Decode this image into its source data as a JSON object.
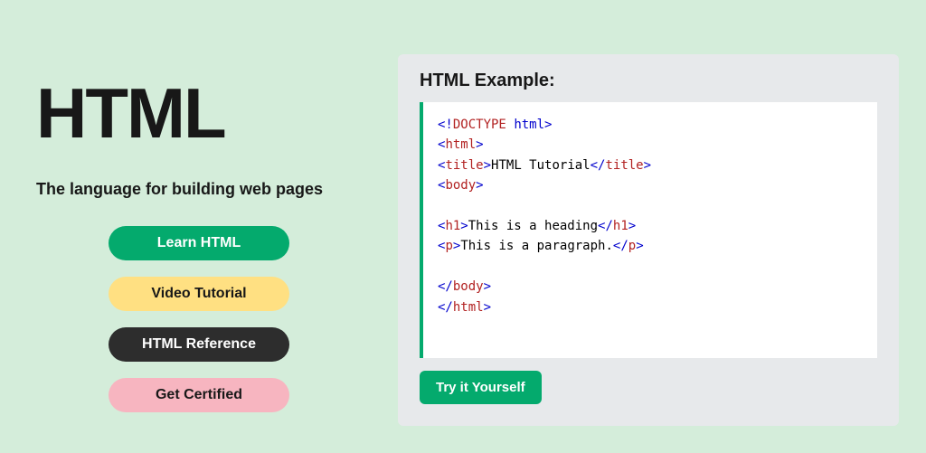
{
  "hero": {
    "title": "HTML",
    "subtitle": "The language for building web pages",
    "buttons": {
      "learn": "Learn HTML",
      "video": "Video Tutorial",
      "reference": "HTML Reference",
      "certified": "Get Certified"
    }
  },
  "example": {
    "title": "HTML Example:",
    "try_button": "Try it Yourself",
    "code": {
      "doctype_open": "<!",
      "doctype_name": "DOCTYPE",
      "doctype_space": " ",
      "doctype_attr": "html",
      "doctype_close": ">",
      "html_open_l": "<",
      "html_tag": "html",
      "html_open_r": ">",
      "title_open_l": "<",
      "title_tag": "title",
      "title_open_r": ">",
      "title_text": "HTML Tutorial",
      "title_close_l": "</",
      "title_close_r": ">",
      "body_open_l": "<",
      "body_tag": "body",
      "body_open_r": ">",
      "h1_open_l": "<",
      "h1_tag": "h1",
      "h1_open_r": ">",
      "h1_text": "This is a heading",
      "h1_close_l": "</",
      "h1_close_r": ">",
      "p_open_l": "<",
      "p_tag": "p",
      "p_open_r": ">",
      "p_text": "This is a paragraph.",
      "p_close_l": "</",
      "p_close_r": ">",
      "body_close_l": "</",
      "body_close_r": ">",
      "html_close_l": "</",
      "html_close_r": ">"
    }
  }
}
